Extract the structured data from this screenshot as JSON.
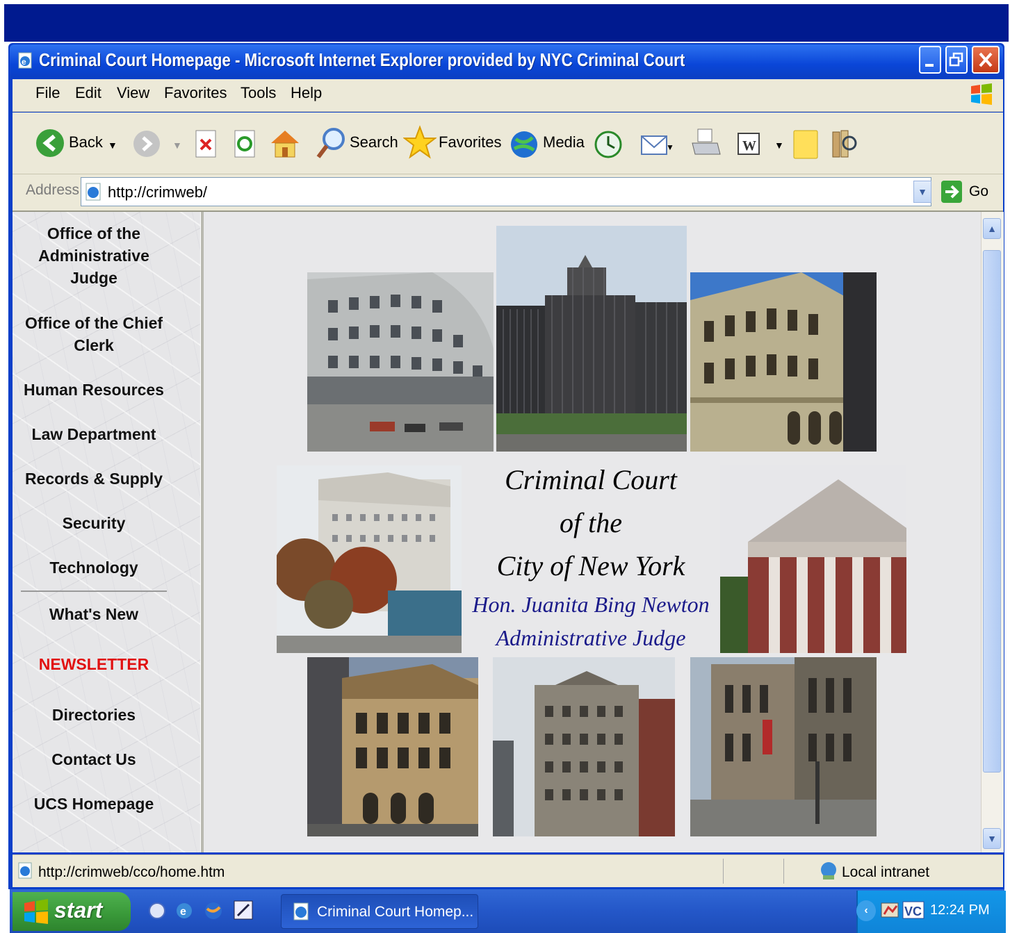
{
  "window": {
    "title": "Criminal Court Homepage - Microsoft Internet Explorer provided by NYC Criminal Court"
  },
  "menu": [
    "File",
    "Edit",
    "View",
    "Favorites",
    "Tools",
    "Help"
  ],
  "toolbar": {
    "back": "Back",
    "search": "Search",
    "favorites": "Favorites",
    "media": "Media"
  },
  "address": {
    "label": "Address",
    "url": "http://crimweb/",
    "go": "Go"
  },
  "nav": {
    "items": [
      "Office of the Administrative Judge",
      "Office of the Chief Clerk",
      "Human Resources",
      "Law Department",
      "Records & Supply",
      "Security",
      "Technology",
      "What's New",
      "NEWSLETTER",
      "Directories",
      "Contact Us",
      "UCS Homepage"
    ]
  },
  "main": {
    "line1": "Criminal Court",
    "line2": "of the",
    "line3": "City of New York",
    "judge": "Hon. Juanita Bing Newton",
    "role": "Administrative Judge"
  },
  "status": {
    "url": "http://crimweb/cco/home.htm",
    "zone": "Local intranet"
  },
  "taskbar": {
    "start": "start",
    "task": "Criminal Court Homep...",
    "clock": "12:24 PM"
  },
  "colors": {
    "newsletter": "#e01010",
    "titlebar": "#0a46d8",
    "judge_text": "#1a1a8a"
  }
}
